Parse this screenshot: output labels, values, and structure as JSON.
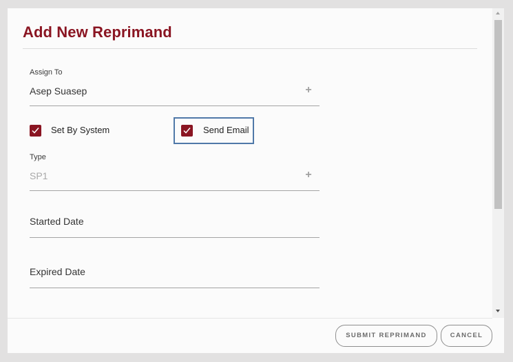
{
  "dialog": {
    "title": "Add New Reprimand",
    "assign_to": {
      "label": "Assign To",
      "value": "Asep Suasep"
    },
    "set_by_system": {
      "label": "Set By System",
      "checked": true
    },
    "send_email": {
      "label": "Send Email",
      "checked": true
    },
    "type": {
      "label": "Type",
      "value": "SP1"
    },
    "started_date": {
      "placeholder": "Started Date"
    },
    "expired_date": {
      "placeholder": "Expired Date"
    },
    "submit_label": "SUBMIT REPRIMAND",
    "cancel_label": "CANCEL"
  },
  "icons": {
    "add": "plus-icon",
    "check": "checkmark-icon"
  },
  "colors": {
    "accent": "#8a1522",
    "focus": "#4f78a8"
  }
}
